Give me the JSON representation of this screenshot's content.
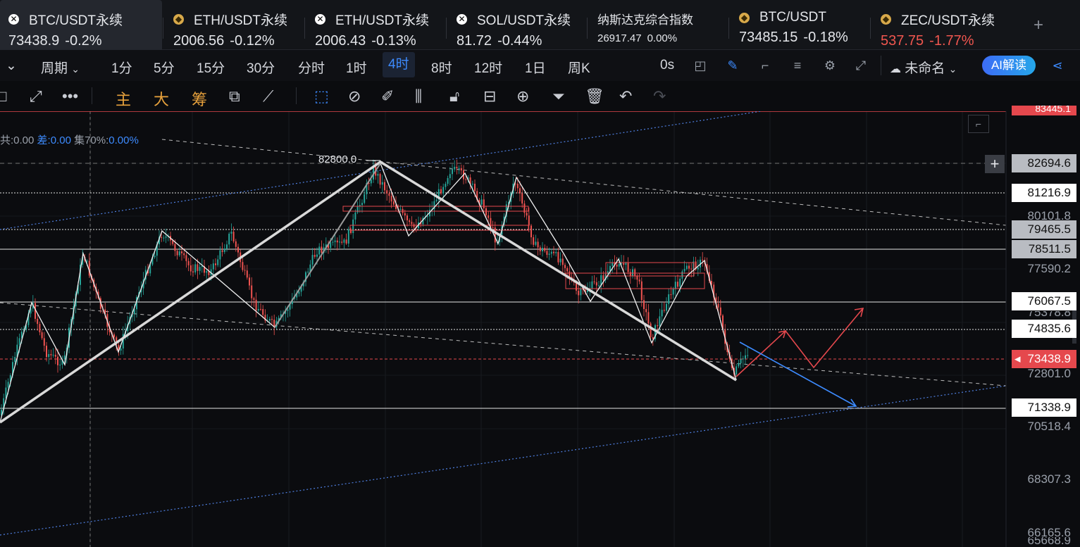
{
  "tickers": [
    {
      "name": "BTC/USDT永续",
      "price": "73438.9",
      "change": "-0.2%",
      "icon": "x-logo-icon",
      "down_red": false
    },
    {
      "name": "ETH/USDT永续",
      "price": "2006.56",
      "change": "-0.12%",
      "icon": "binance-icon",
      "down_red": false
    },
    {
      "name": "ETH/USDT永续",
      "price": "2006.43",
      "change": "-0.13%",
      "icon": "x-logo-icon",
      "down_red": false
    },
    {
      "name": "SOL/USDT永续",
      "price": "81.72",
      "change": "-0.44%",
      "icon": "x-logo-icon",
      "down_red": false
    },
    {
      "name": "纳斯达克综合指数",
      "price": "26917.47",
      "change": "0.00%",
      "icon": "",
      "down_red": false
    },
    {
      "name": "BTC/USDT",
      "price": "73485.15",
      "change": "-0.18%",
      "icon": "binance-icon",
      "down_red": false
    },
    {
      "name": "ZEC/USDT永续",
      "price": "537.75",
      "change": "-1.77%",
      "icon": "binance-icon",
      "down_red": true
    }
  ],
  "add_tab": "+",
  "period_label": "周期",
  "periods": [
    "1分",
    "5分",
    "15分",
    "30分",
    "分时",
    "1时",
    "4时",
    "8时",
    "12时",
    "1日",
    "周K"
  ],
  "selected_period": "4时",
  "countdown": "0s",
  "layout_name": "未命名",
  "ai_button": "AI解读",
  "toolbar_text": {
    "main": "主",
    "big": "大",
    "chips": "筹"
  },
  "indicator": {
    "prefix1": "共:0.00",
    "label2": "差:",
    "val2": "0.00",
    "label3": "集70%:",
    "val3": "0.00%"
  },
  "peak_label": "82800.0",
  "price_labels": {
    "top_partial": "83445.1",
    "l82694": "82694.6",
    "l81216": "81216.9",
    "l80101": "80101.8",
    "l79465": "79465.5",
    "l78511": "78511.5",
    "l77590": "77590.2",
    "l76067": "76067.5",
    "l75xxx": "75378.8",
    "l74835": "74835.6",
    "l73438": "73438.9",
    "l72801": "72801.0",
    "l71338": "71338.9",
    "l70518": "70518.4",
    "l68307": "68307.3",
    "l66165": "66165.6",
    "l65668": "65668.9"
  },
  "colors": {
    "up": "#26a69a",
    "down": "#ef5350",
    "accent": "#3d8bff",
    "bg": "#0b0c0f"
  }
}
